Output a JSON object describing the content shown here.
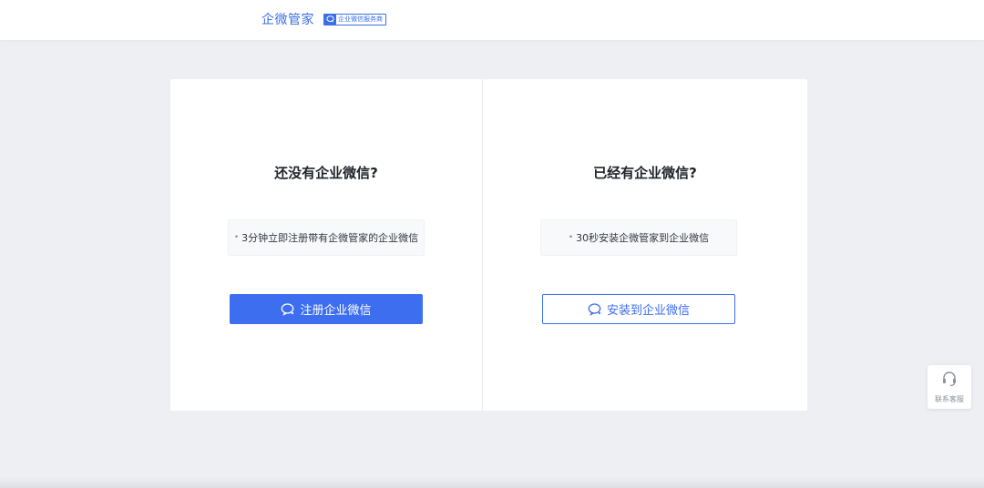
{
  "header": {
    "brand_name": "企微管家",
    "badge_text": "企业微信服务商",
    "badge_icon": "chat-bubble-icon"
  },
  "left": {
    "title": "还没有企业微信?",
    "tip": "3分钟立即注册带有企微管家的企业微信",
    "button_label": "注册企业微信"
  },
  "right": {
    "title": "已经有企业微信?",
    "tip": "30秒安装企微管家到企业微信",
    "button_label": "安装到企业微信"
  },
  "support": {
    "label": "联系客服",
    "icon": "headset-icon"
  },
  "colors": {
    "accent": "#3d6ef0",
    "background": "#eeeff3"
  }
}
